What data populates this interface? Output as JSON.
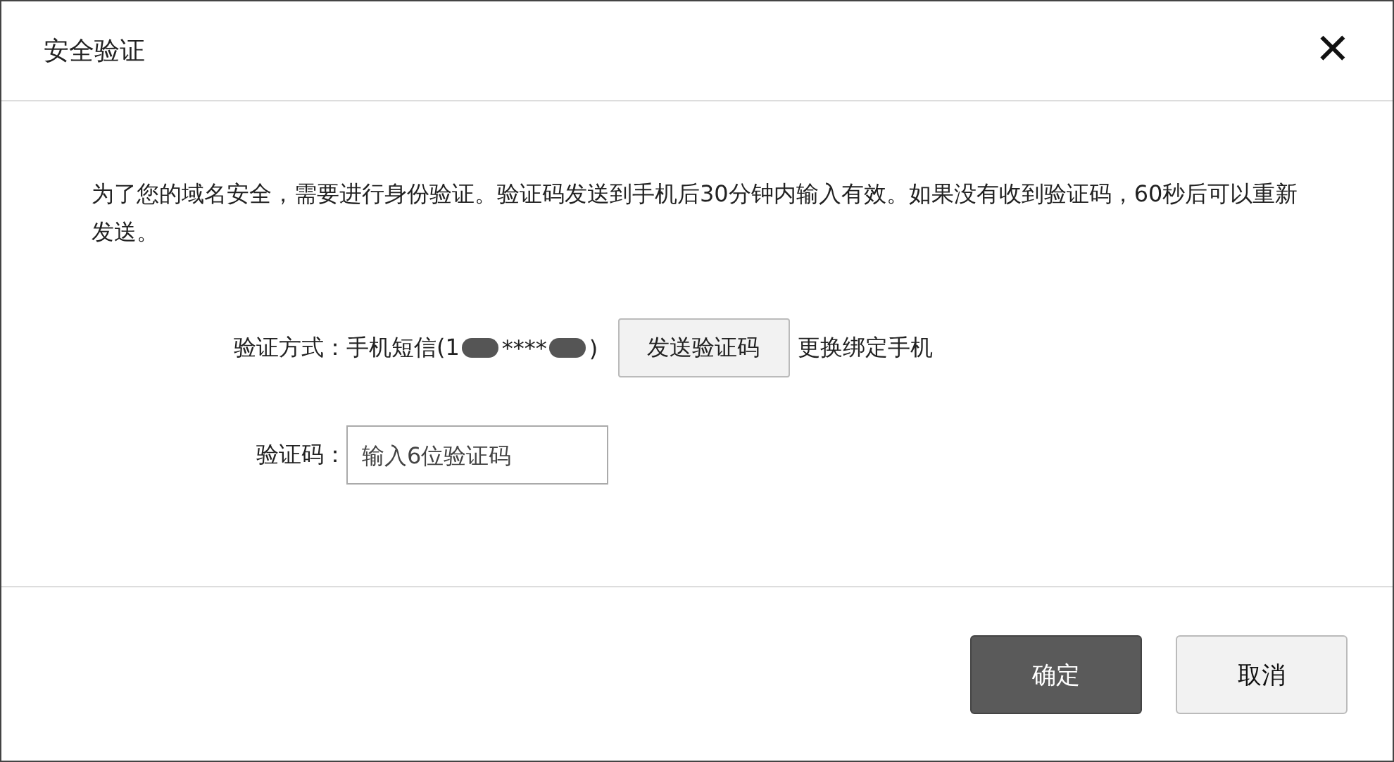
{
  "dialog": {
    "title": "安全验证",
    "close": "✕"
  },
  "notice": "为了您的域名安全，需要进行身份验证。验证码发送到手机后30分钟内输入有效。如果没有收到验证码，60秒后可以重新发送。",
  "method": {
    "label": "验证方式：",
    "parts": [
      {
        "kind": "text",
        "text": "手机短信(1"
      },
      {
        "kind": "redaction"
      },
      {
        "kind": "text",
        "text": "****"
      },
      {
        "kind": "redaction"
      },
      {
        "kind": "text",
        "text": ")"
      }
    ],
    "send_button": "发送验证码",
    "change_link": "更换绑定手机"
  },
  "code": {
    "label": "验证码：",
    "placeholder": "输入6位验证码"
  },
  "buttons": [
    {
      "label": "确定",
      "kind": "primary"
    },
    {
      "label": "取消",
      "kind": "secondary"
    }
  ]
}
